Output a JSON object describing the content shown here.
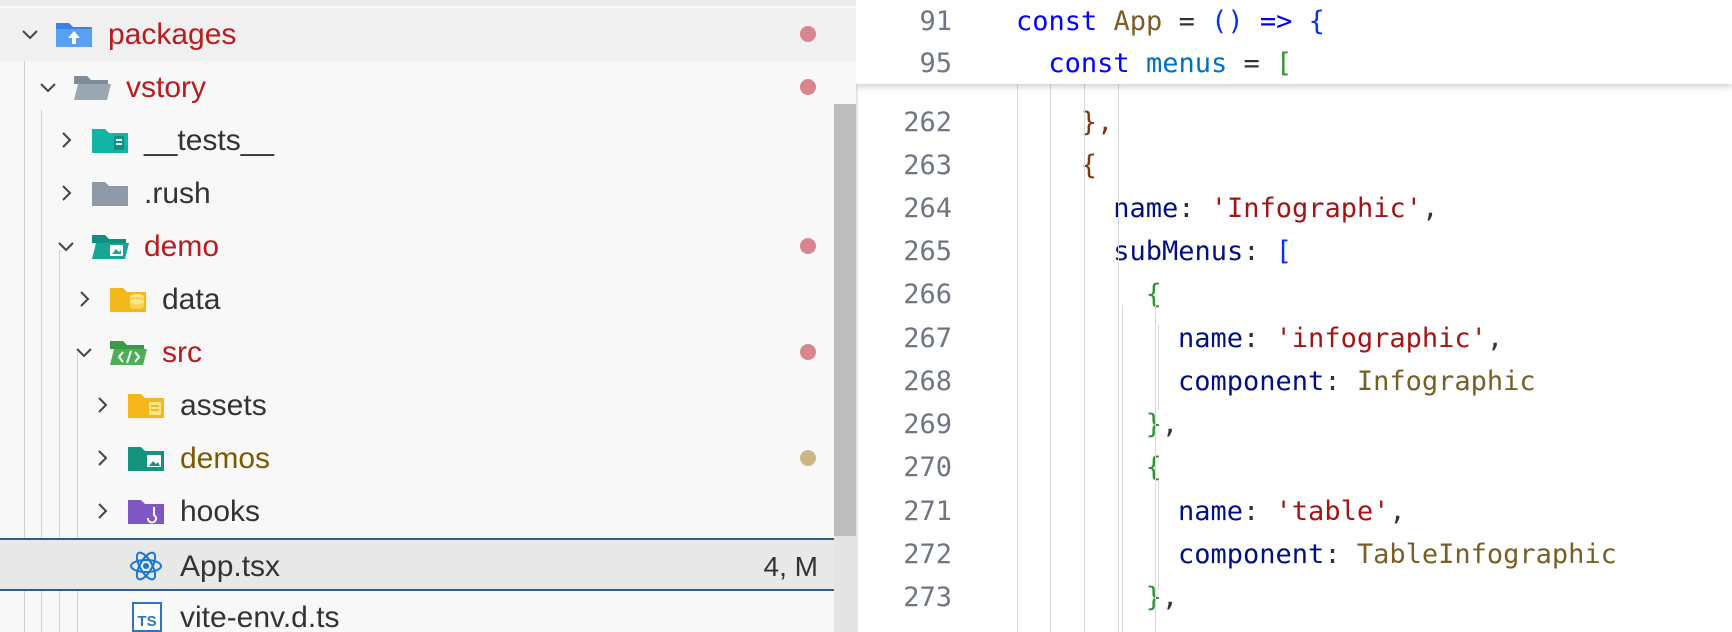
{
  "explorer": {
    "rows": [
      {
        "label": "packages",
        "icon": "folder-packages-open-icon",
        "status": "modified"
      },
      {
        "label": "vstory",
        "icon": "folder-open-icon",
        "status": "modified"
      },
      {
        "label": "__tests__",
        "icon": "folder-tests-icon",
        "status": "none"
      },
      {
        "label": ".rush",
        "icon": "folder-icon",
        "status": "none"
      },
      {
        "label": "demo",
        "icon": "folder-demo-open-icon",
        "status": "modified"
      },
      {
        "label": "data",
        "icon": "folder-data-icon",
        "status": "none"
      },
      {
        "label": "src",
        "icon": "folder-src-open-icon",
        "status": "modified"
      },
      {
        "label": "assets",
        "icon": "folder-assets-icon",
        "status": "none"
      },
      {
        "label": "demos",
        "icon": "folder-images-icon",
        "status": "untracked"
      },
      {
        "label": "hooks",
        "icon": "folder-hooks-icon",
        "status": "none"
      },
      {
        "label": "App.tsx",
        "icon": "react-icon",
        "status": "selected",
        "badge": "4, M"
      },
      {
        "label": "vite-env.d.ts",
        "icon": "typescript-icon",
        "status": "none"
      }
    ]
  },
  "editor": {
    "sticky": [
      {
        "line": "91",
        "tokens": [
          [
            "const",
            "kw"
          ],
          [
            " ",
            "p"
          ],
          [
            "App",
            "fn"
          ],
          [
            " = ",
            "p"
          ],
          [
            "()",
            "b2"
          ],
          [
            " => ",
            "kw"
          ],
          [
            "{",
            "b2"
          ]
        ]
      },
      {
        "line": "95",
        "tokens": [
          [
            "const",
            "kw"
          ],
          [
            " ",
            "p"
          ],
          [
            "menus",
            "id"
          ],
          [
            " = ",
            "p"
          ],
          [
            "[",
            "b3"
          ]
        ]
      }
    ],
    "lines": [
      {
        "line": "262",
        "tokens": [
          [
            "},",
            "brack"
          ]
        ]
      },
      {
        "line": "263",
        "tokens": [
          [
            "{",
            "brack"
          ]
        ]
      },
      {
        "line": "264",
        "tokens": [
          [
            "name",
            "var"
          ],
          [
            ": ",
            "p"
          ],
          [
            "'Infographic'",
            "str"
          ],
          [
            ",",
            "p"
          ]
        ]
      },
      {
        "line": "265",
        "tokens": [
          [
            "subMenus",
            "var"
          ],
          [
            ": ",
            "p"
          ],
          [
            "[",
            "b2"
          ]
        ]
      },
      {
        "line": "266",
        "tokens": [
          [
            "{",
            "b3"
          ]
        ]
      },
      {
        "line": "267",
        "tokens": [
          [
            "name",
            "var"
          ],
          [
            ": ",
            "p"
          ],
          [
            "'infographic'",
            "str"
          ],
          [
            ",",
            "p"
          ]
        ]
      },
      {
        "line": "268",
        "tokens": [
          [
            "component",
            "var"
          ],
          [
            ": ",
            "p"
          ],
          [
            "Infographic",
            "fn"
          ]
        ]
      },
      {
        "line": "269",
        "tokens": [
          [
            "}",
            "b3"
          ],
          [
            ",",
            "p"
          ]
        ]
      },
      {
        "line": "270",
        "tokens": [
          [
            "{",
            "b3"
          ]
        ]
      },
      {
        "line": "271",
        "tokens": [
          [
            "name",
            "var"
          ],
          [
            ": ",
            "p"
          ],
          [
            "'table'",
            "str"
          ],
          [
            ",",
            "p"
          ]
        ]
      },
      {
        "line": "272",
        "tokens": [
          [
            "component",
            "var"
          ],
          [
            ": ",
            "p"
          ],
          [
            "TableInfographic",
            "fn"
          ]
        ]
      },
      {
        "line": "273",
        "tokens": [
          [
            "}",
            "b3"
          ],
          [
            ",",
            "p"
          ]
        ]
      }
    ]
  },
  "colors": {
    "modified_dot": "#d9858f",
    "untracked_dot": "#cbb784",
    "selection_border": "#2d5d8f"
  }
}
